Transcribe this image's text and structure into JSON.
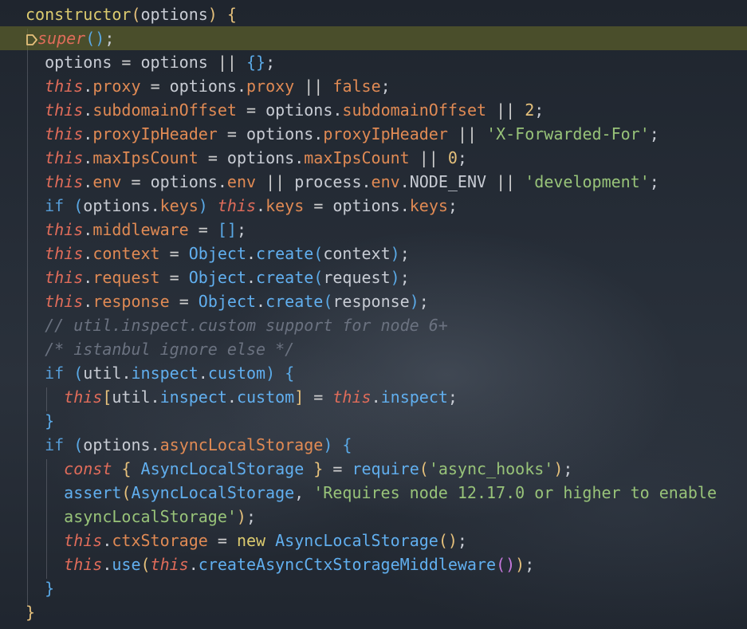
{
  "editor": {
    "lines": [
      {
        "t": [
          [
            "kw-fn",
            "constructor"
          ],
          [
            "punc-y",
            "("
          ],
          [
            "plain",
            "options"
          ],
          [
            "punc-y",
            ")"
          ],
          [
            "plain",
            " "
          ],
          [
            "punc-y",
            "{"
          ]
        ]
      },
      {
        "t": [
          [
            "kw-ital",
            "super"
          ],
          [
            "punc-b",
            "()"
          ],
          [
            "plain",
            ";"
          ]
        ],
        "highlight": true
      },
      {
        "t": [
          [
            "plain",
            "  options "
          ],
          [
            "op",
            "="
          ],
          [
            "plain",
            " options "
          ],
          [
            "op",
            "||"
          ],
          [
            "plain",
            " "
          ],
          [
            "punc-b",
            "{}"
          ],
          [
            "plain",
            ";"
          ]
        ]
      },
      {
        "t": [
          [
            "plain",
            "  "
          ],
          [
            "this",
            "this"
          ],
          [
            "plain",
            "."
          ],
          [
            "prop",
            "proxy"
          ],
          [
            "plain",
            " "
          ],
          [
            "op",
            "="
          ],
          [
            "plain",
            " options."
          ],
          [
            "prop",
            "proxy"
          ],
          [
            "plain",
            " "
          ],
          [
            "op",
            "||"
          ],
          [
            "plain",
            " "
          ],
          [
            "prop",
            "false"
          ],
          [
            "plain",
            ";"
          ]
        ]
      },
      {
        "t": [
          [
            "plain",
            "  "
          ],
          [
            "this",
            "this"
          ],
          [
            "plain",
            "."
          ],
          [
            "prop",
            "subdomainOffset"
          ],
          [
            "plain",
            " "
          ],
          [
            "op",
            "="
          ],
          [
            "plain",
            " options."
          ],
          [
            "prop",
            "subdomainOffset"
          ],
          [
            "plain",
            " "
          ],
          [
            "op",
            "||"
          ],
          [
            "plain",
            " "
          ],
          [
            "num",
            "2"
          ],
          [
            "plain",
            ";"
          ]
        ]
      },
      {
        "t": [
          [
            "plain",
            "  "
          ],
          [
            "this",
            "this"
          ],
          [
            "plain",
            "."
          ],
          [
            "prop",
            "proxyIpHeader"
          ],
          [
            "plain",
            " "
          ],
          [
            "op",
            "="
          ],
          [
            "plain",
            " options."
          ],
          [
            "prop",
            "proxyIpHeader"
          ],
          [
            "plain",
            " "
          ],
          [
            "op",
            "||"
          ],
          [
            "plain",
            " "
          ],
          [
            "str",
            "'X-Forwarded-For'"
          ],
          [
            "plain",
            ";"
          ]
        ]
      },
      {
        "t": [
          [
            "plain",
            "  "
          ],
          [
            "this",
            "this"
          ],
          [
            "plain",
            "."
          ],
          [
            "prop",
            "maxIpsCount"
          ],
          [
            "plain",
            " "
          ],
          [
            "op",
            "="
          ],
          [
            "plain",
            " options."
          ],
          [
            "prop",
            "maxIpsCount"
          ],
          [
            "plain",
            " "
          ],
          [
            "op",
            "||"
          ],
          [
            "plain",
            " "
          ],
          [
            "num",
            "0"
          ],
          [
            "plain",
            ";"
          ]
        ]
      },
      {
        "t": [
          [
            "plain",
            "  "
          ],
          [
            "this",
            "this"
          ],
          [
            "plain",
            "."
          ],
          [
            "prop",
            "env"
          ],
          [
            "plain",
            " "
          ],
          [
            "op",
            "="
          ],
          [
            "plain",
            " options."
          ],
          [
            "prop",
            "env"
          ],
          [
            "plain",
            " "
          ],
          [
            "op",
            "||"
          ],
          [
            "plain",
            " process."
          ],
          [
            "prop",
            "env"
          ],
          [
            "plain",
            ".NODE_ENV "
          ],
          [
            "op",
            "||"
          ],
          [
            "plain",
            " "
          ],
          [
            "str",
            "'development'"
          ],
          [
            "plain",
            ";"
          ]
        ]
      },
      {
        "t": [
          [
            "plain",
            "  "
          ],
          [
            "ctl",
            "if"
          ],
          [
            "plain",
            " "
          ],
          [
            "punc-b",
            "("
          ],
          [
            "plain",
            "options."
          ],
          [
            "prop",
            "keys"
          ],
          [
            "punc-b",
            ")"
          ],
          [
            "plain",
            " "
          ],
          [
            "this",
            "this"
          ],
          [
            "plain",
            "."
          ],
          [
            "prop",
            "keys"
          ],
          [
            "plain",
            " "
          ],
          [
            "op",
            "="
          ],
          [
            "plain",
            " options."
          ],
          [
            "prop",
            "keys"
          ],
          [
            "plain",
            ";"
          ]
        ]
      },
      {
        "t": [
          [
            "plain",
            "  "
          ],
          [
            "this",
            "this"
          ],
          [
            "plain",
            "."
          ],
          [
            "prop",
            "middleware"
          ],
          [
            "plain",
            " "
          ],
          [
            "op",
            "="
          ],
          [
            "plain",
            " "
          ],
          [
            "punc-b",
            "[]"
          ],
          [
            "plain",
            ";"
          ]
        ]
      },
      {
        "t": [
          [
            "plain",
            "  "
          ],
          [
            "this",
            "this"
          ],
          [
            "plain",
            "."
          ],
          [
            "prop",
            "context"
          ],
          [
            "plain",
            " "
          ],
          [
            "op",
            "="
          ],
          [
            "plain",
            " "
          ],
          [
            "obj",
            "Object"
          ],
          [
            "plain",
            "."
          ],
          [
            "fn",
            "create"
          ],
          [
            "punc-b",
            "("
          ],
          [
            "plain",
            "context"
          ],
          [
            "punc-b",
            ")"
          ],
          [
            "plain",
            ";"
          ]
        ]
      },
      {
        "t": [
          [
            "plain",
            "  "
          ],
          [
            "this",
            "this"
          ],
          [
            "plain",
            "."
          ],
          [
            "prop",
            "request"
          ],
          [
            "plain",
            " "
          ],
          [
            "op",
            "="
          ],
          [
            "plain",
            " "
          ],
          [
            "obj",
            "Object"
          ],
          [
            "plain",
            "."
          ],
          [
            "fn",
            "create"
          ],
          [
            "punc-b",
            "("
          ],
          [
            "plain",
            "request"
          ],
          [
            "punc-b",
            ")"
          ],
          [
            "plain",
            ";"
          ]
        ]
      },
      {
        "t": [
          [
            "plain",
            "  "
          ],
          [
            "this",
            "this"
          ],
          [
            "plain",
            "."
          ],
          [
            "prop",
            "response"
          ],
          [
            "plain",
            " "
          ],
          [
            "op",
            "="
          ],
          [
            "plain",
            " "
          ],
          [
            "obj",
            "Object"
          ],
          [
            "plain",
            "."
          ],
          [
            "fn",
            "create"
          ],
          [
            "punc-b",
            "("
          ],
          [
            "plain",
            "response"
          ],
          [
            "punc-b",
            ")"
          ],
          [
            "plain",
            ";"
          ]
        ]
      },
      {
        "t": [
          [
            "cmt",
            "  // util.inspect.custom support for node 6+"
          ]
        ]
      },
      {
        "t": [
          [
            "cmt",
            "  /* istanbul ignore else */"
          ]
        ]
      },
      {
        "t": [
          [
            "plain",
            "  "
          ],
          [
            "ctl",
            "if"
          ],
          [
            "plain",
            " "
          ],
          [
            "punc-b",
            "("
          ],
          [
            "plain",
            "util."
          ],
          [
            "fn",
            "inspect"
          ],
          [
            "plain",
            "."
          ],
          [
            "fn",
            "custom"
          ],
          [
            "punc-b",
            ")"
          ],
          [
            "plain",
            " "
          ],
          [
            "punc-b",
            "{"
          ]
        ]
      },
      {
        "t": [
          [
            "plain",
            "    "
          ],
          [
            "this",
            "this"
          ],
          [
            "punc-y",
            "["
          ],
          [
            "plain",
            "util."
          ],
          [
            "fn",
            "inspect"
          ],
          [
            "plain",
            "."
          ],
          [
            "fn",
            "custom"
          ],
          [
            "punc-y",
            "]"
          ],
          [
            "plain",
            " "
          ],
          [
            "op",
            "="
          ],
          [
            "plain",
            " "
          ],
          [
            "this",
            "this"
          ],
          [
            "plain",
            "."
          ],
          [
            "fn",
            "inspect"
          ],
          [
            "plain",
            ";"
          ]
        ]
      },
      {
        "t": [
          [
            "plain",
            "  "
          ],
          [
            "punc-b",
            "}"
          ]
        ]
      },
      {
        "t": [
          [
            "plain",
            "  "
          ],
          [
            "ctl",
            "if"
          ],
          [
            "plain",
            " "
          ],
          [
            "punc-b",
            "("
          ],
          [
            "plain",
            "options."
          ],
          [
            "prop",
            "asyncLocalStorage"
          ],
          [
            "punc-b",
            ")"
          ],
          [
            "plain",
            " "
          ],
          [
            "punc-b",
            "{"
          ]
        ]
      },
      {
        "t": [
          [
            "plain",
            "    "
          ],
          [
            "this",
            "const"
          ],
          [
            "plain",
            " "
          ],
          [
            "punc-y",
            "{"
          ],
          [
            "plain",
            " "
          ],
          [
            "obj",
            "AsyncLocalStorage"
          ],
          [
            "plain",
            " "
          ],
          [
            "punc-y",
            "}"
          ],
          [
            "plain",
            " "
          ],
          [
            "op",
            "="
          ],
          [
            "plain",
            " "
          ],
          [
            "fn",
            "require"
          ],
          [
            "punc-y",
            "("
          ],
          [
            "str",
            "'async_hooks'"
          ],
          [
            "punc-y",
            ")"
          ],
          [
            "plain",
            ";"
          ]
        ]
      },
      {
        "t": [
          [
            "plain",
            "    "
          ],
          [
            "fn",
            "assert"
          ],
          [
            "punc-y",
            "("
          ],
          [
            "obj",
            "AsyncLocalStorage"
          ],
          [
            "plain",
            ", "
          ],
          [
            "str",
            "'Requires node 12.17.0 or higher to enable"
          ]
        ]
      },
      {
        "t": [
          [
            "plain",
            "    "
          ],
          [
            "str",
            "asyncLocalStorage'"
          ],
          [
            "punc-y",
            ")"
          ],
          [
            "plain",
            ";"
          ]
        ]
      },
      {
        "t": [
          [
            "plain",
            "    "
          ],
          [
            "this",
            "this"
          ],
          [
            "plain",
            "."
          ],
          [
            "prop",
            "ctxStorage"
          ],
          [
            "plain",
            " "
          ],
          [
            "op",
            "="
          ],
          [
            "plain",
            " "
          ],
          [
            "kw-fn",
            "new"
          ],
          [
            "plain",
            " "
          ],
          [
            "obj",
            "AsyncLocalStorage"
          ],
          [
            "punc-y",
            "()"
          ],
          [
            "plain",
            ";"
          ]
        ]
      },
      {
        "t": [
          [
            "plain",
            "    "
          ],
          [
            "this",
            "this"
          ],
          [
            "plain",
            "."
          ],
          [
            "fn",
            "use"
          ],
          [
            "punc-y",
            "("
          ],
          [
            "this",
            "this"
          ],
          [
            "plain",
            "."
          ],
          [
            "fn",
            "createAsyncCtxStorageMiddleware"
          ],
          [
            "punc-p",
            "()"
          ],
          [
            "punc-y",
            ")"
          ],
          [
            "plain",
            ";"
          ]
        ]
      },
      {
        "t": [
          [
            "plain",
            "  "
          ],
          [
            "punc-b",
            "}"
          ]
        ]
      },
      {
        "t": [
          [
            "punc-y",
            "}"
          ]
        ]
      }
    ]
  }
}
